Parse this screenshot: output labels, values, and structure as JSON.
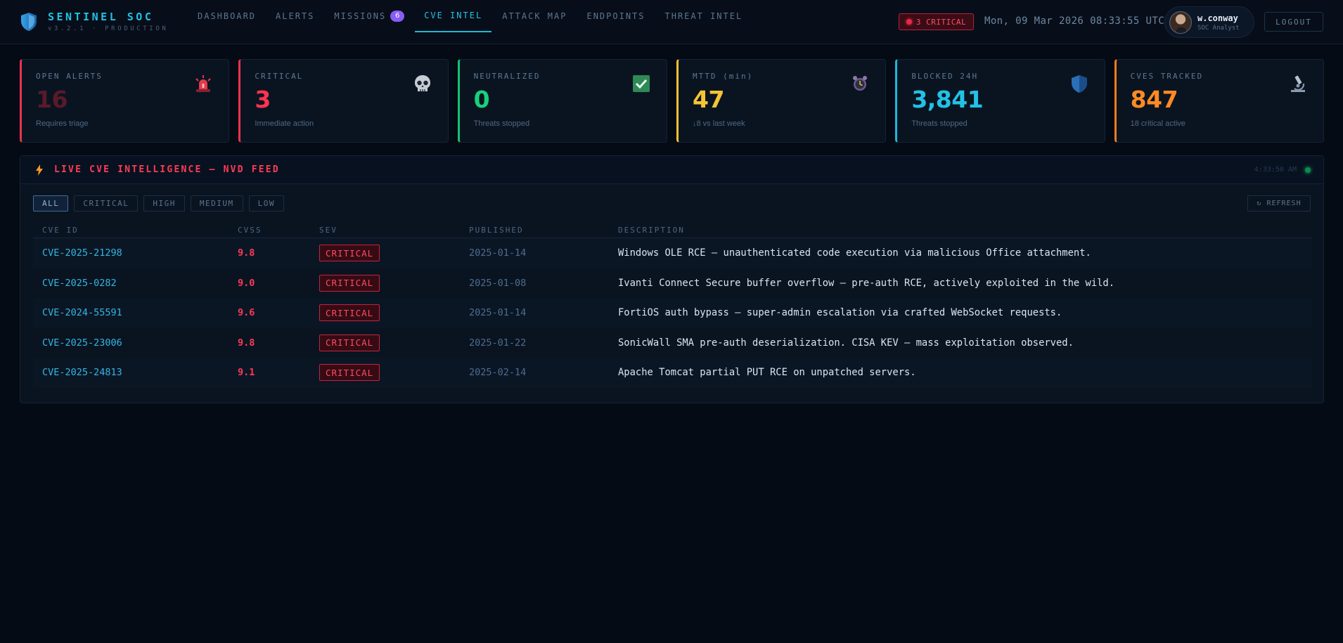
{
  "brand": {
    "title": "SENTINEL SOC",
    "subtitle": "v3.2.1 · PRODUCTION"
  },
  "nav": {
    "items": [
      {
        "label": "DASHBOARD"
      },
      {
        "label": "ALERTS"
      },
      {
        "label": "MISSIONS",
        "badge": "6"
      },
      {
        "label": "CVE INTEL",
        "active": true
      },
      {
        "label": "ATTACK MAP"
      },
      {
        "label": "ENDPOINTS"
      },
      {
        "label": "THREAT INTEL"
      }
    ]
  },
  "header": {
    "critical_pill": "3 CRITICAL",
    "clock": "Mon, 09 Mar 2026 08:33:55 UTC",
    "user": {
      "name": "w.conway",
      "role": "SOC Analyst"
    },
    "logout_label": "LOGOUT"
  },
  "stats": [
    {
      "label": "OPEN ALERTS",
      "value": "16",
      "sub": "Requires triage",
      "color": "#e8334f",
      "value_color": "#5a1a28",
      "icon": "siren-icon"
    },
    {
      "label": "CRITICAL",
      "value": "3",
      "sub": "Immediate action",
      "color": "#e8334f",
      "value_color": "#ff3350",
      "icon": "skull-icon"
    },
    {
      "label": "NEUTRALIZED",
      "value": "0",
      "sub": "Threats stopped",
      "color": "#16c172",
      "value_color": "#19d07a",
      "icon": "check-box-icon"
    },
    {
      "label": "MTTD (min)",
      "value": "47",
      "sub": "↓8 vs last week",
      "color": "#f2c230",
      "value_color": "#f6c433",
      "icon": "alarm-clock-icon"
    },
    {
      "label": "BLOCKED 24H",
      "value": "3,841",
      "sub": "Threats stopped",
      "color": "#1db6db",
      "value_color": "#22c1e6",
      "icon": "shield-icon"
    },
    {
      "label": "CVES TRACKED",
      "value": "847",
      "sub": "18 critical active",
      "color": "#f27c1e",
      "value_color": "#ff8a24",
      "icon": "microscope-icon"
    }
  ],
  "panel": {
    "title": "LIVE CVE INTELLIGENCE — NVD FEED",
    "time": "4:33:50 AM",
    "filters": [
      {
        "label": "ALL",
        "active": true
      },
      {
        "label": "CRITICAL"
      },
      {
        "label": "HIGH"
      },
      {
        "label": "MEDIUM"
      },
      {
        "label": "LOW"
      }
    ],
    "refresh_label": "↻ REFRESH",
    "columns": [
      "CVE ID",
      "CVSS",
      "SEV",
      "PUBLISHED",
      "DESCRIPTION"
    ],
    "rows": [
      {
        "id": "CVE-2025-21298",
        "cvss": "9.8",
        "sev": "CRITICAL",
        "published": "2025-01-14",
        "desc": "Windows OLE RCE — unauthenticated code execution via malicious Office attachment."
      },
      {
        "id": "CVE-2025-0282",
        "cvss": "9.0",
        "sev": "CRITICAL",
        "published": "2025-01-08",
        "desc": "Ivanti Connect Secure buffer overflow — pre-auth RCE, actively exploited in the wild."
      },
      {
        "id": "CVE-2024-55591",
        "cvss": "9.6",
        "sev": "CRITICAL",
        "published": "2025-01-14",
        "desc": "FortiOS auth bypass — super-admin escalation via crafted WebSocket requests."
      },
      {
        "id": "CVE-2025-23006",
        "cvss": "9.8",
        "sev": "CRITICAL",
        "published": "2025-01-22",
        "desc": "SonicWall SMA pre-auth deserialization. CISA KEV — mass exploitation observed."
      },
      {
        "id": "CVE-2025-24813",
        "cvss": "9.1",
        "sev": "CRITICAL",
        "published": "2025-02-14",
        "desc": "Apache Tomcat partial PUT RCE on unpatched servers."
      }
    ]
  }
}
